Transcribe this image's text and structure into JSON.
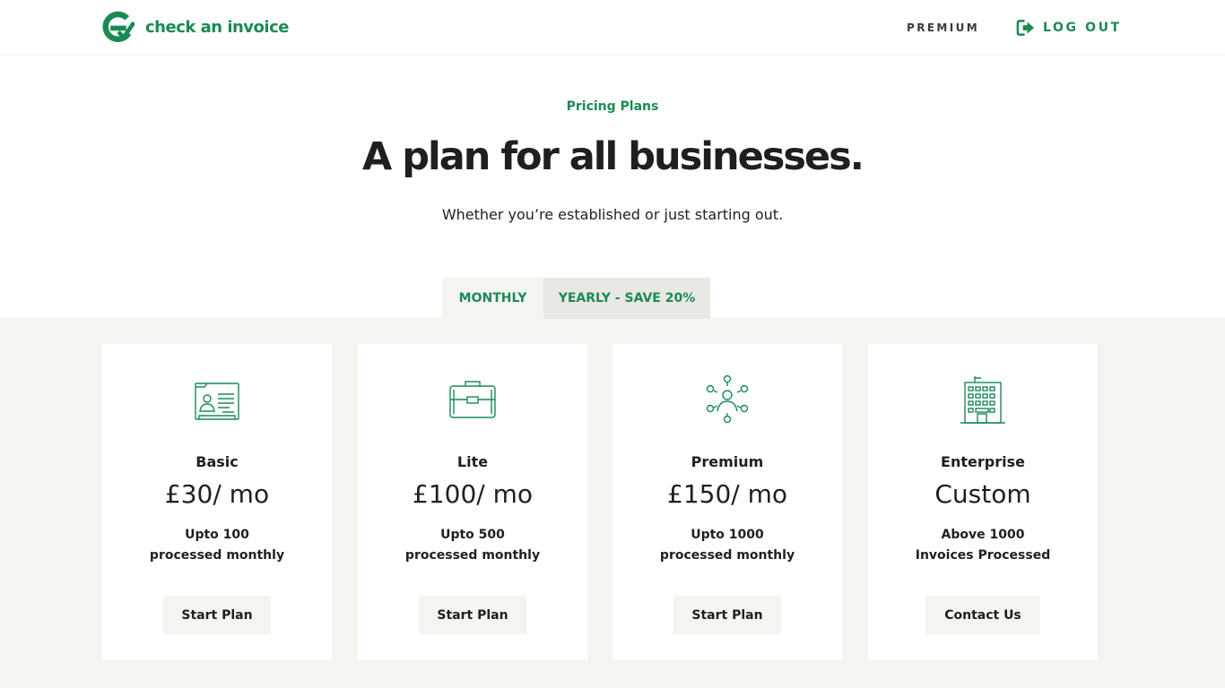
{
  "header": {
    "brand": "check an invoice",
    "nav_premium": "PREMIUM",
    "nav_logout": "LOG OUT"
  },
  "hero": {
    "eyebrow": "Pricing Plans",
    "title": "A plan for all businesses.",
    "subtitle": "Whether you’re established or just starting out."
  },
  "billing_toggle": {
    "monthly": "MONTHLY",
    "yearly": "YEARLY - SAVE 20%"
  },
  "plans": [
    {
      "icon": "id-card-icon",
      "name": "Basic",
      "price": "£30/ mo",
      "desc1": "Upto 100",
      "desc2": "processed monthly",
      "button": "Start Plan"
    },
    {
      "icon": "briefcase-icon",
      "name": "Lite",
      "price": "£100/ mo",
      "desc1": "Upto 500",
      "desc2": "processed monthly",
      "button": "Start Plan"
    },
    {
      "icon": "network-icon",
      "name": "Premium",
      "price": "£150/ mo",
      "desc1": "Upto 1000",
      "desc2": "processed monthly",
      "button": "Start Plan"
    },
    {
      "icon": "office-building-icon",
      "name": "Enterprise",
      "price": "Custom",
      "desc1": "Above 1000",
      "desc2": "Invoices Processed",
      "button": "Contact Us"
    }
  ],
  "colors": {
    "brand_green": "#1a8a55",
    "band_background": "#f5f4f1",
    "text": "#1f1f1f"
  }
}
